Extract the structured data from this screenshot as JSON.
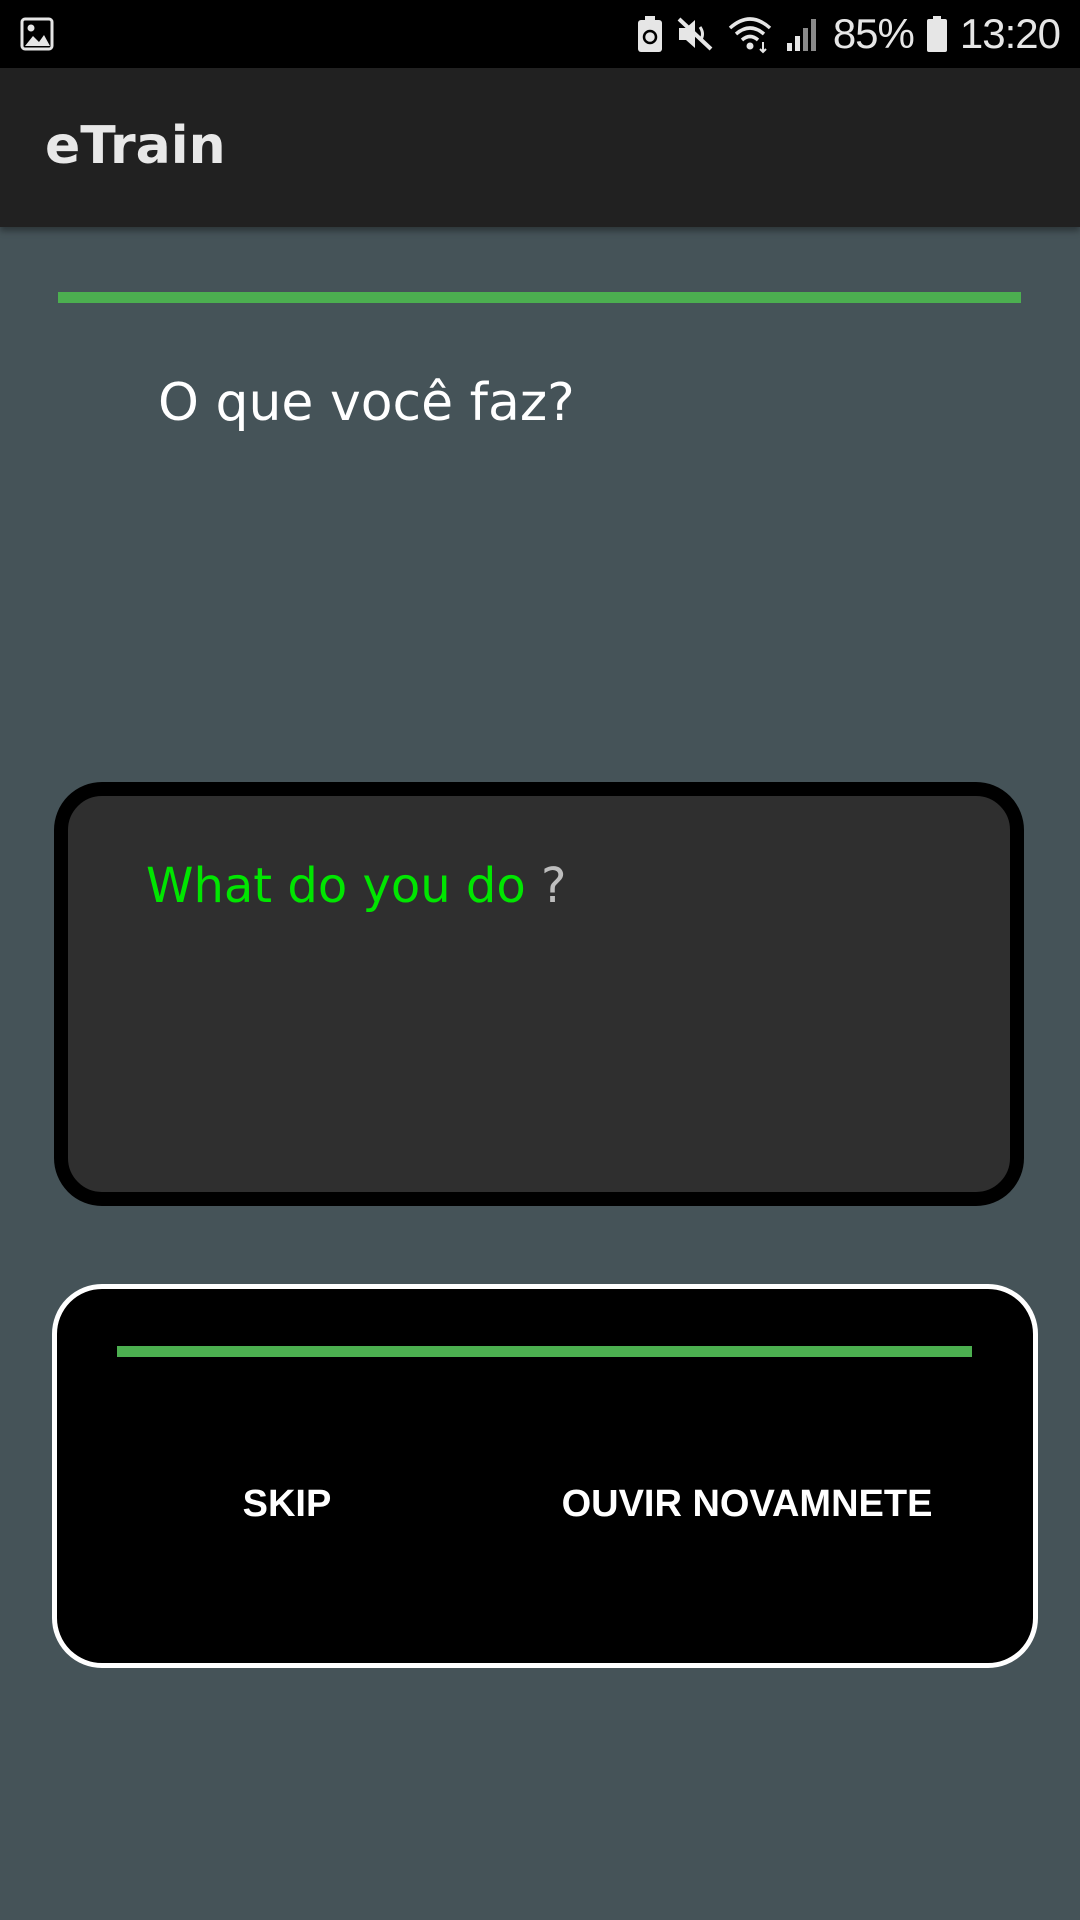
{
  "status_bar": {
    "battery_percent": "85%",
    "time": "13:20",
    "icons": [
      "image-icon",
      "battery-saver-icon",
      "mute-icon",
      "wifi-icon",
      "signal-icon",
      "battery-icon"
    ]
  },
  "app_bar": {
    "title": "eTrain"
  },
  "lesson": {
    "progress": 1.0,
    "prompt": "O que você faz?"
  },
  "answer": {
    "matched_text": "What do you do",
    "remaining_text": " ?"
  },
  "controls": {
    "progress": 1.0,
    "skip_label": "SKIP",
    "replay_label": "OUVIR NOVAMNETE"
  },
  "colors": {
    "background": "#455358",
    "app_bar": "#212121",
    "accent_progress": "#4caf50",
    "match_text": "#00e600",
    "card": "#2f2f2f"
  }
}
